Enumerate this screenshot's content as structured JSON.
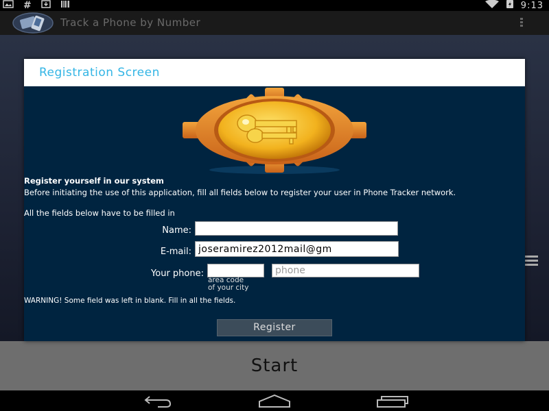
{
  "status_bar": {
    "time": "9:13",
    "hash_symbol": "#",
    "icons": [
      "image-notification-icon",
      "hashtag-icon",
      "download-icon",
      "barcode-icon",
      "wifi-icon",
      "battery-charging-icon"
    ]
  },
  "action_bar": {
    "title": "Track a Phone by Number",
    "icon": "app-logo-icon",
    "menu_icon": "overflow-menu-icon"
  },
  "dialog": {
    "title": "Registration Screen",
    "heading": "Register yourself in our system",
    "intro": "Before initiating the use of this application, fill all fields below to register your user in Phone Tracker network.",
    "fields_note": "All the fields below have to be filled in",
    "name": {
      "label": "Name:",
      "value": ""
    },
    "email": {
      "label": "E-mail:",
      "value": "joseramirez2012mail@gm"
    },
    "phone": {
      "label": "Your phone:",
      "area_code_value": "",
      "number_placeholder": "phone",
      "area_code_hint_line1": "área code",
      "area_code_hint_line2": "of your city"
    },
    "warning": "WARNING! Some field was left in blank. Fill in all the fields.",
    "register_label": "Register"
  },
  "start_label": "Start",
  "colors": {
    "dialog_bg": "#002440",
    "title_accent": "#33b5e5",
    "gear": "#e8902a",
    "coin": "#f2b21e"
  }
}
